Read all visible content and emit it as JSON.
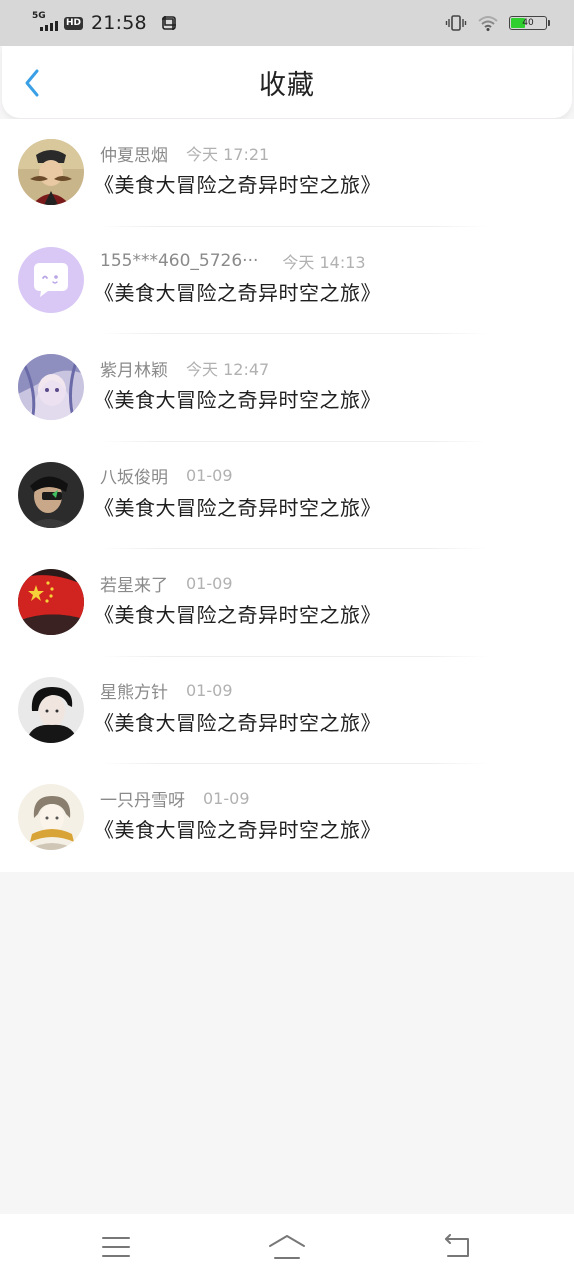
{
  "status_bar": {
    "network": "5G",
    "hd": "HD",
    "time": "21:58",
    "battery_level": "40",
    "battery_fraction": 0.4,
    "battery_color": "#2fcf2f"
  },
  "header": {
    "title": "收藏",
    "back_icon": "chevron-left-icon",
    "accent_color": "#3aa0e6"
  },
  "items": [
    {
      "username": "仲夏思烟",
      "time": "今天 17:21",
      "title": "《美食大冒险之奇异时空之旅》"
    },
    {
      "username": "155***460_5726···",
      "time": "今天 14:13",
      "title": "《美食大冒险之奇异时空之旅》"
    },
    {
      "username": "紫月林颖",
      "time": "今天 12:47",
      "title": "《美食大冒险之奇异时空之旅》"
    },
    {
      "username": "八坂俊明",
      "time": "01-09",
      "title": "《美食大冒险之奇异时空之旅》"
    },
    {
      "username": "若星来了",
      "time": "01-09",
      "title": "《美食大冒险之奇异时空之旅》"
    },
    {
      "username": "星熊方针",
      "time": "01-09",
      "title": "《美食大冒险之奇异时空之旅》"
    },
    {
      "username": "一只丹雪呀",
      "time": "01-09",
      "title": "《美食大冒险之奇异时空之旅》"
    }
  ],
  "nav_bar": {
    "menu_icon": "menu-icon",
    "home_icon": "home-icon",
    "back_icon": "back-icon"
  }
}
